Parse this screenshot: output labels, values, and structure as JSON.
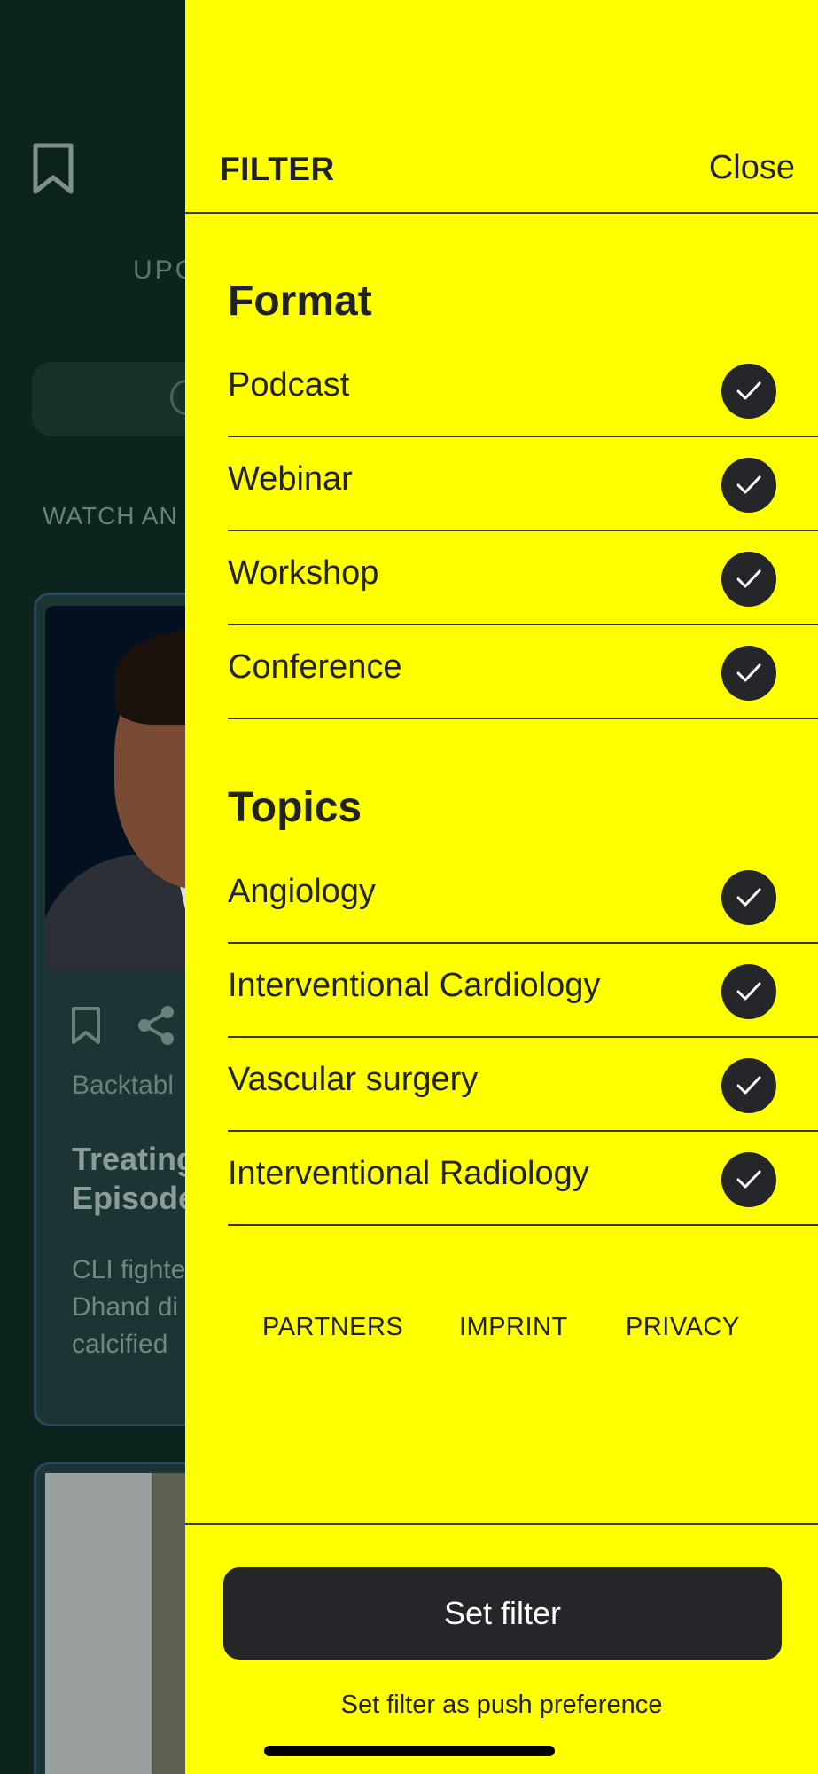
{
  "background": {
    "tab_partial": "UPC",
    "section_partial": "WATCH AN",
    "card": {
      "source_partial": "Backtabl",
      "title_partial": "Treating\nEpisode",
      "description_partial": "CLI fighte\nDhand di\ncalcified"
    },
    "icons": [
      "bookmark-icon",
      "share-icon"
    ]
  },
  "filter": {
    "title": "FILTER",
    "close_label": "Close",
    "format": {
      "heading": "Format",
      "options": [
        {
          "label": "Podcast",
          "checked": true
        },
        {
          "label": "Webinar",
          "checked": true
        },
        {
          "label": "Workshop",
          "checked": true
        },
        {
          "label": "Conference",
          "checked": true
        }
      ]
    },
    "topics": {
      "heading": "Topics",
      "options": [
        {
          "label": "Angiology",
          "checked": true
        },
        {
          "label": "Interventional Cardiology",
          "checked": true
        },
        {
          "label": "Vascular surgery",
          "checked": true
        },
        {
          "label": "Interventional Radiology",
          "checked": true
        }
      ]
    },
    "footer_links": [
      "PARTNERS",
      "IMPRINT",
      "PRIVACY"
    ],
    "set_filter_label": "Set filter",
    "push_preference_label": "Set filter as push preference"
  },
  "colors": {
    "panel_bg": "#ffff00",
    "checkbox_fill": "#25262a",
    "button_bg": "#25262a",
    "background_app": "#0d231d"
  }
}
